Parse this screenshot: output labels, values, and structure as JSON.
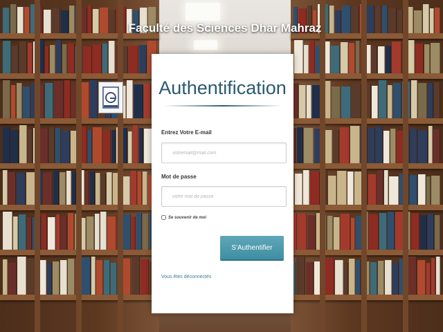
{
  "site": {
    "title": "Faculté des Sciences Dhar Mahraz"
  },
  "login": {
    "heading": "Authentification",
    "email_label": "Entrez Votre E-mail",
    "email_placeholder": "votremail@mail.com",
    "email_value": "",
    "password_label": "Mot de passe",
    "password_placeholder": "votre mot de passe",
    "password_value": "",
    "remember_label": "Se souvenir de moi",
    "remember_checked": false,
    "submit_label": "S'Authentifier",
    "status_text": "Vous êtes déconnectés"
  },
  "icons": {
    "logo": "faculty-logo-icon"
  },
  "colors": {
    "accent": "#3f8ea3",
    "heading": "#2b5a70",
    "card": "#ffffff"
  }
}
